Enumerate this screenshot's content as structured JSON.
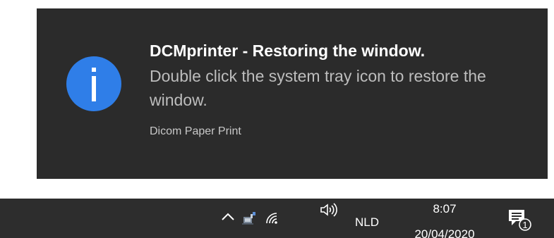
{
  "toast": {
    "title": "DCMprinter - Restoring the window.",
    "body": "Double click the system tray icon to restore the window.",
    "source": "Dicom Paper Print",
    "icon": "info-icon",
    "icon_color": "#2f7ee8",
    "background": "#2b2b2b"
  },
  "taskbar": {
    "tray_icons": [
      "chevron-up-icon",
      "usb-device-icon",
      "wifi-icon",
      "speaker-icon"
    ],
    "language": "NLD",
    "time": "8:07",
    "date": "20/04/2020",
    "notification_count": "1",
    "background": "#2d2d2d"
  }
}
